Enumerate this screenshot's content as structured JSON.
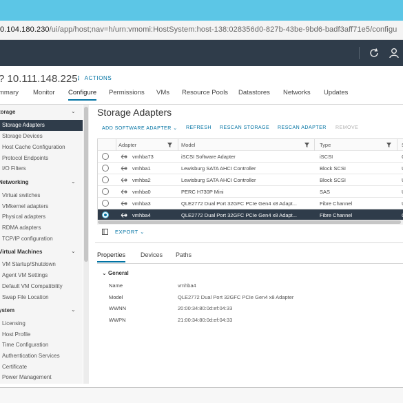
{
  "browser": {
    "url_host": "0.104.180.230",
    "url_path": "/ui/app/host;nav=h/urn:vmomi:HostSystem:host-138:028356d0-827b-43be-9bd6-badf3aff71e5/configu"
  },
  "header": {
    "host_title": "? 10.111.148.225",
    "actions_icon": "⋮",
    "actions_label": "ACTIONS",
    "tabs": [
      "mmary",
      "Monitor",
      "Configure",
      "Permissions",
      "VMs",
      "Resource Pools",
      "Datastores",
      "Networks",
      "Updates"
    ],
    "active_tab": "Configure"
  },
  "sidebar": {
    "sections": [
      {
        "title": "torage",
        "items": [
          "Storage Adapters",
          "Storage Devices",
          "Host Cache Configuration",
          "Protocol Endpoints",
          "I/O Filters"
        ]
      },
      {
        "title": "Networking",
        "items": [
          "Virtual switches",
          "VMkernel adapters",
          "Physical adapters",
          "RDMA adapters",
          "TCP/IP configuration"
        ]
      },
      {
        "title": "Virtual Machines",
        "items": [
          "VM Startup/Shutdown",
          "Agent VM Settings",
          "Default VM Compatibility",
          "Swap File Location"
        ]
      },
      {
        "title": "ystem",
        "items": [
          "Licensing",
          "Host Profile",
          "Time Configuration",
          "Authentication Services",
          "Certificate",
          "Power Management"
        ]
      }
    ],
    "active_item": "Storage Adapters"
  },
  "main": {
    "title": "Storage Adapters",
    "toolbar": {
      "add": "ADD SOFTWARE ADAPTER ⌄",
      "refresh": "REFRESH",
      "rescan_storage": "RESCAN STORAGE",
      "rescan_adapter": "RESCAN ADAPTER",
      "remove": "REMOVE"
    },
    "grid": {
      "columns": [
        "Adapter",
        "Model",
        "Type",
        "S"
      ],
      "rows": [
        {
          "adapter": "vmhba73",
          "model": "iSCSI Software Adapter",
          "type": "iSCSI",
          "status": "C"
        },
        {
          "adapter": "vmhba1",
          "model": "Lewisburg SATA AHCI Controller",
          "type": "Block SCSI",
          "status": "U"
        },
        {
          "adapter": "vmhba2",
          "model": "Lewisburg SATA AHCI Controller",
          "type": "Block SCSI",
          "status": "U"
        },
        {
          "adapter": "vmhba0",
          "model": "PERC H730P Mini",
          "type": "SAS",
          "status": "U"
        },
        {
          "adapter": "vmhba3",
          "model": "QLE2772 Dual Port 32GFC PCIe Gen4 x8 Adapt...",
          "type": "Fibre Channel",
          "status": "U"
        },
        {
          "adapter": "vmhba4",
          "model": "QLE2772 Dual Port 32GFC PCIe Gen4 x8 Adapt...",
          "type": "Fibre Channel",
          "status": "C"
        }
      ],
      "selected_row": 5
    },
    "export_label": "EXPORT ⌄",
    "detail_tabs": [
      "Properties",
      "Devices",
      "Paths"
    ],
    "active_detail_tab": "Properties",
    "general": {
      "heading": "General",
      "props": [
        {
          "label": "Name",
          "value": "vmhba4"
        },
        {
          "label": "Model",
          "value": "QLE2772 Dual Port 32GFC PCIe Gen4 x8 Adapter"
        },
        {
          "label": "WWNN",
          "value": "20:00:34:80:0d:ef:04:33"
        },
        {
          "label": "WWPN",
          "value": "21:00:34:80:0d:ef:04:33"
        }
      ]
    }
  },
  "colors": {
    "accent": "#0072a3",
    "header_bg": "#2f3c4a",
    "selected_bg": "#2f3c4a",
    "browser_bar": "#5cc6e6"
  }
}
